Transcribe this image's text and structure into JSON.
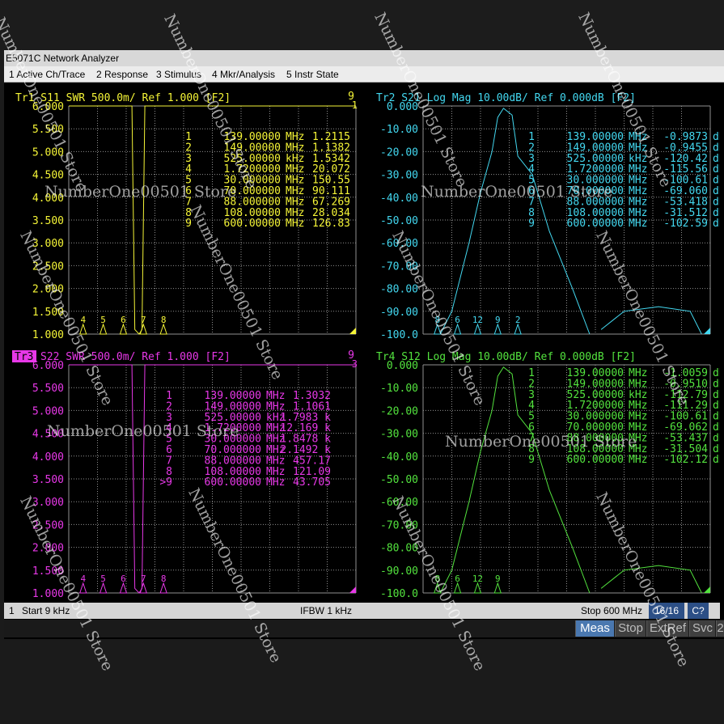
{
  "window": {
    "title": "E5071C Network Analyzer"
  },
  "menu": [
    "1 Active Ch/Trace",
    "2 Response",
    "3 Stimulus",
    "4 Mkr/Analysis",
    "5 Instr State"
  ],
  "colors": {
    "tr1": "#f5f537",
    "tr2": "#43d8f0",
    "tr3": "#e838e8",
    "tr4": "#53e33e",
    "grid": "#8f8f8f",
    "softkey_active": "#4a78b0"
  },
  "panels": [
    {
      "id": "tr1",
      "header": "Tr1  S11  SWR  500.0m/  Ref  1.000  [F2]",
      "header_right": "9",
      "corner_label": "1",
      "y_ticks": [
        "6.000",
        "5.500",
        "5.000",
        "4.500",
        "4.000",
        "3.500",
        "3.000",
        "2.500",
        "2.000",
        "1.500",
        "1.000"
      ],
      "marker_flags": [
        "4",
        "5",
        "6",
        "7",
        "8"
      ],
      "markers": [
        {
          "n": "1",
          "freq": "139.00000",
          "unit": "MHz",
          "val": "1.2115"
        },
        {
          "n": "2",
          "freq": "149.00000",
          "unit": "MHz",
          "val": "1.1382"
        },
        {
          "n": "3",
          "freq": "525.00000",
          "unit": "kHz",
          "val": "1.5342"
        },
        {
          "n": "4",
          "freq": "1.7200000",
          "unit": "MHz",
          "val": "20.072"
        },
        {
          "n": "5",
          "freq": "30.000000",
          "unit": "MHz",
          "val": "150.55"
        },
        {
          "n": "6",
          "freq": "70.000000",
          "unit": "MHz",
          "val": "90.111"
        },
        {
          "n": "7",
          "freq": "88.000000",
          "unit": "MHz",
          "val": "67.269"
        },
        {
          "n": "8",
          "freq": "108.00000",
          "unit": "MHz",
          "val": "28.034"
        },
        {
          "n": "9",
          "freq": "600.00000",
          "unit": "MHz",
          "val": "126.83"
        }
      ]
    },
    {
      "id": "tr2",
      "header": "Tr2  S21  Log Mag  10.00dB/  Ref  0.000dB  [F2]",
      "y_ticks": [
        "0.000",
        "-10.00",
        "-20.00",
        "-30.00",
        "-40.00",
        "-50.00",
        "-60.00",
        "-70.00",
        "-80.00",
        "-90.00",
        "-100.0"
      ],
      "marker_flags": [
        "8",
        "6",
        "12",
        "9",
        "2"
      ],
      "markers": [
        {
          "n": "1",
          "freq": "139.00000",
          "unit": "MHz",
          "val": "-0.9873",
          "u2": "dB"
        },
        {
          "n": "2",
          "freq": "149.00000",
          "unit": "MHz",
          "val": "-0.9455",
          "u2": "dB"
        },
        {
          "n": "3",
          "freq": "525.00000",
          "unit": "kHz",
          "val": "-120.42",
          "u2": "dB"
        },
        {
          "n": "4",
          "freq": "1.7200000",
          "unit": "MHz",
          "val": "-115.56",
          "u2": "dB"
        },
        {
          "n": "5",
          "freq": "30.000000",
          "unit": "MHz",
          "val": "-100.61",
          "u2": "dB"
        },
        {
          "n": "6",
          "freq": "70.000000",
          "unit": "MHz",
          "val": "-69.060",
          "u2": "dB"
        },
        {
          "n": "7",
          "freq": "88.000000",
          "unit": "MHz",
          "val": "-53.418",
          "u2": "dB"
        },
        {
          "n": "8",
          "freq": "108.00000",
          "unit": "MHz",
          "val": "-31.512",
          "u2": "dB"
        },
        {
          "n": "9",
          "freq": "600.00000",
          "unit": "MHz",
          "val": "-102.59",
          "u2": "dB"
        }
      ]
    },
    {
      "id": "tr3",
      "header_label": "Tr3",
      "header": "S22  SWR  500.0m/  Ref  1.000  [F2]",
      "header_right": "9",
      "corner_label": "3",
      "y_ticks": [
        "6.000",
        "5.500",
        "5.000",
        "4.500",
        "4.000",
        "3.500",
        "3.000",
        "2.500",
        "2.000",
        "1.500",
        "1.000"
      ],
      "marker_flags": [
        "4",
        "5",
        "6",
        "7",
        "8"
      ],
      "markers": [
        {
          "n": "1",
          "freq": "139.00000",
          "unit": "MHz",
          "val": "1.3032"
        },
        {
          "n": "2",
          "freq": "149.00000",
          "unit": "MHz",
          "val": "1.1061"
        },
        {
          "n": "3",
          "freq": "525.00000",
          "unit": "kHz",
          "val": "1.7983 k"
        },
        {
          "n": "4",
          "freq": "1.7200000",
          "unit": "MHz",
          "val": "12.169 k"
        },
        {
          "n": "5",
          "freq": "30.000000",
          "unit": "MHz",
          "val": "1.8478 k"
        },
        {
          "n": "6",
          "freq": "70.000000",
          "unit": "MHz",
          "val": "2.1492 k"
        },
        {
          "n": "7",
          "freq": "88.000000",
          "unit": "MHz",
          "val": "457.17"
        },
        {
          "n": "8",
          "freq": "108.00000",
          "unit": "MHz",
          "val": "121.09"
        },
        {
          "n": ">9",
          "freq": "600.00000",
          "unit": "MHz",
          "val": "43.705"
        }
      ]
    },
    {
      "id": "tr4",
      "header": "Tr4  S12  Log Mag  10.00dB/  Ref  0.000dB  [F2]",
      "y_ticks": [
        "0.000",
        "-10.00",
        "-20.00",
        "-30.00",
        "-40.00",
        "-50.00",
        "-60.00",
        "-70.00",
        "-80.00",
        "-90.00",
        "-100.0"
      ],
      "marker_flags": [
        "8",
        "6",
        "12",
        "9"
      ],
      "markers": [
        {
          "n": "1",
          "freq": "139.00000",
          "unit": "MHz",
          "val": "-1.0059",
          "u2": "dB"
        },
        {
          "n": "2",
          "freq": "149.00000",
          "unit": "MHz",
          "val": "-0.9510",
          "u2": "dB"
        },
        {
          "n": "3",
          "freq": "525.00000",
          "unit": "kHz",
          "val": "-112.79",
          "u2": "dB"
        },
        {
          "n": "4",
          "freq": "1.7200000",
          "unit": "MHz",
          "val": "-111.29",
          "u2": "dB"
        },
        {
          "n": "5",
          "freq": "30.000000",
          "unit": "MHz",
          "val": "-100.61",
          "u2": "dB"
        },
        {
          "n": "6",
          "freq": "70.000000",
          "unit": "MHz",
          "val": "-69.062",
          "u2": "dB"
        },
        {
          "n": "7",
          "freq": "88.000000",
          "unit": "MHz",
          "val": "-53.437",
          "u2": "dB"
        },
        {
          "n": "8",
          "freq": "108.00000",
          "unit": "MHz",
          "val": "-31.504",
          "u2": "dB"
        },
        {
          "n": "9",
          "freq": "600.00000",
          "unit": "MHz",
          "val": "-102.12",
          "u2": "dB"
        }
      ]
    }
  ],
  "status": {
    "channel": "1",
    "start": "Start 9 kHz",
    "ifbw": "IFBW 1 kHz",
    "stop": "Stop 600 MHz",
    "points": "16/16",
    "cal": "C?"
  },
  "softkeys": [
    "Meas",
    "Stop",
    "ExtRef",
    "Svc",
    "2"
  ],
  "watermark": "NumberOne00501 Store"
}
